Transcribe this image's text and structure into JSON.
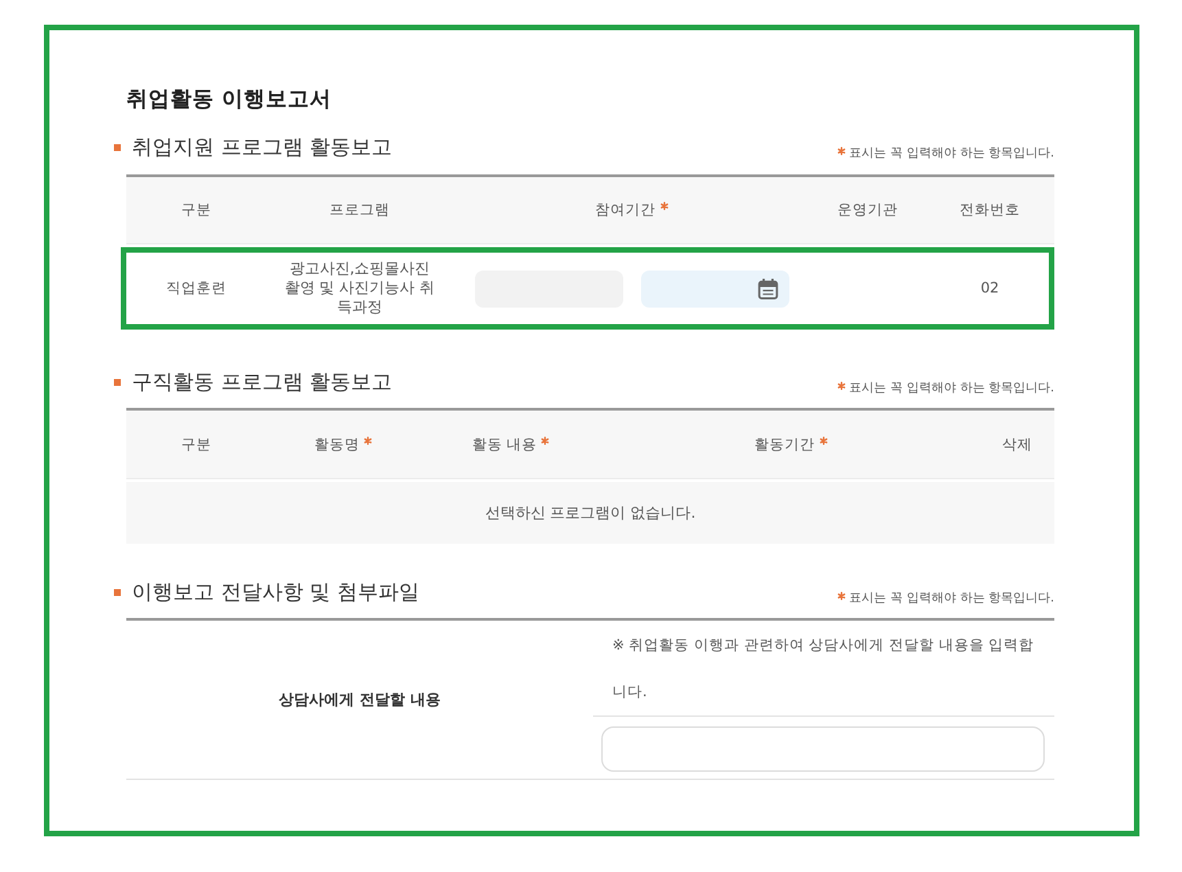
{
  "page": {
    "title": "취업활동 이행보고서"
  },
  "sections": [
    {
      "kind": "program_table",
      "title": "취업지원 프로그램 활동보고",
      "note": "표시는 꼭 입력해야 하는 항목입니다.",
      "columns": [
        {
          "label": "구분",
          "required": false
        },
        {
          "label": "프로그램",
          "required": false
        },
        {
          "label": "참여기간",
          "required": true
        },
        {
          "label": "운영기관",
          "required": false
        },
        {
          "label": "전화번호",
          "required": false
        }
      ],
      "rows": [
        {
          "highlighted": true,
          "category": "직업훈련",
          "program": "광고사진,쇼핑몰사진 촬영 및 사진기능사 취득과정",
          "period": [
            {
              "kind": "plain"
            },
            {
              "kind": "picker"
            }
          ],
          "phone": "02"
        }
      ]
    },
    {
      "kind": "activity_table",
      "title": "구직활동 프로그램 활동보고",
      "note": "표시는 꼭 입력해야 하는 항목입니다.",
      "columns": [
        {
          "label": "구분",
          "required": false
        },
        {
          "label": "활동명",
          "required": true
        },
        {
          "label": "활동 내용",
          "required": true
        },
        {
          "label": "활동기간",
          "required": true
        },
        {
          "label": "삭제",
          "required": false
        }
      ],
      "empty_message": "선택하신 프로그램이 없습니다."
    },
    {
      "kind": "message_form",
      "title": "이행보고 전달사항 및 첨부파일",
      "note": "표시는 꼭 입력해야 하는 항목입니다.",
      "label": "상담사에게 전달할 내용",
      "help_text": "※ 취업활동 이행과 관련하여 상담사에게 전달할 내용을 입력합니다."
    }
  ]
}
